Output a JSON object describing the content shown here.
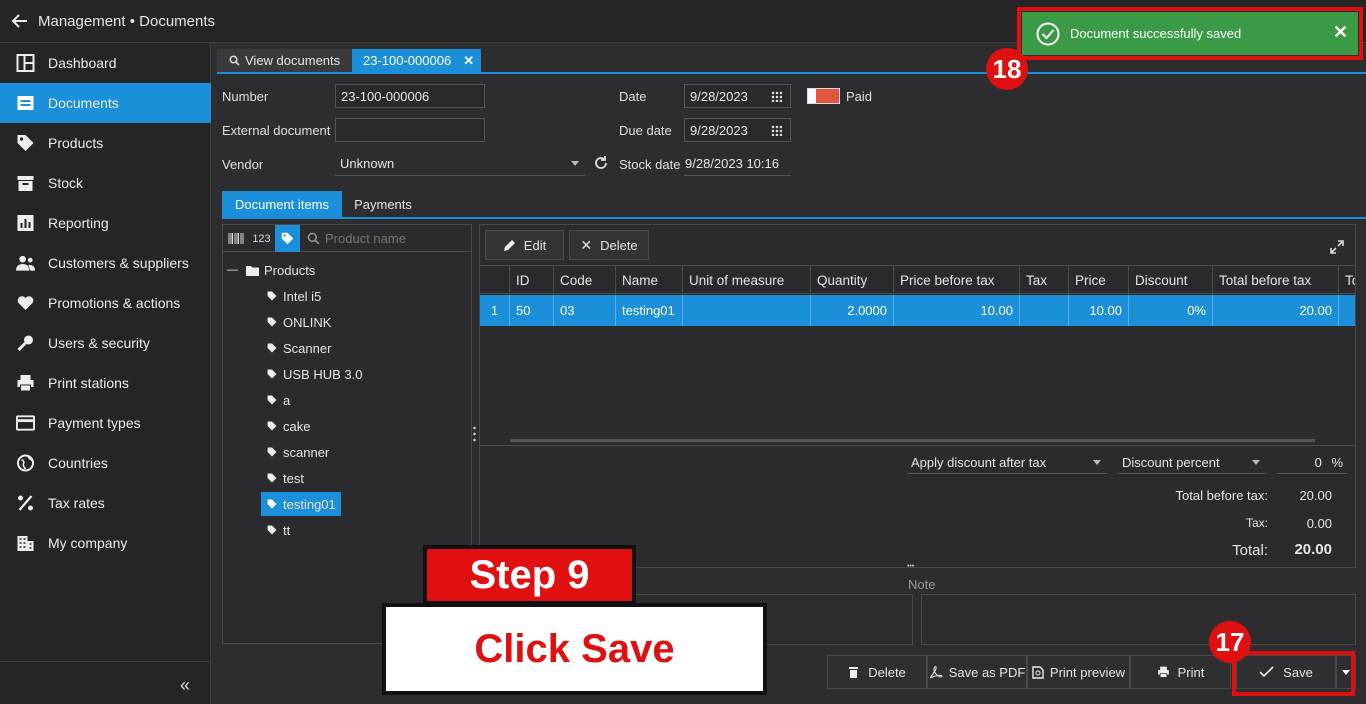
{
  "app": {
    "title": "Management • Documents"
  },
  "sidebar": {
    "items": [
      {
        "label": "Dashboard",
        "icon": "dashboard-icon"
      },
      {
        "label": "Documents",
        "icon": "documents-icon",
        "active": true
      },
      {
        "label": "Products",
        "icon": "tag-icon"
      },
      {
        "label": "Stock",
        "icon": "box-icon"
      },
      {
        "label": "Reporting",
        "icon": "chart-icon"
      },
      {
        "label": "Customers & suppliers",
        "icon": "people-icon"
      },
      {
        "label": "Promotions & actions",
        "icon": "heart-icon"
      },
      {
        "label": "Users & security",
        "icon": "key-icon"
      },
      {
        "label": "Print stations",
        "icon": "printer-icon"
      },
      {
        "label": "Payment types",
        "icon": "card-icon"
      },
      {
        "label": "Countries",
        "icon": "globe-icon"
      },
      {
        "label": "Tax rates",
        "icon": "percent-icon"
      },
      {
        "label": "My company",
        "icon": "building-icon"
      }
    ],
    "collapse_label": "«"
  },
  "tabs": {
    "view": "View documents",
    "doc": "23-100-000006",
    "close": "✕"
  },
  "form": {
    "number_label": "Number",
    "number_value": "23-100-000006",
    "external_label": "External document",
    "external_value": "",
    "vendor_label": "Vendor",
    "vendor_value": "Unknown",
    "date_label": "Date",
    "date_value": "9/28/2023",
    "due_label": "Due date",
    "due_value": "9/28/2023",
    "stock_label": "Stock date",
    "stock_value": "9/28/2023 10:16",
    "paid_label": "Paid"
  },
  "subtabs": {
    "items": "Document items",
    "payments": "Payments"
  },
  "tree": {
    "toolbar": {
      "barcode": "",
      "code": "123"
    },
    "search_placeholder": "Product name",
    "root": "Products",
    "root_toggle": "—",
    "children": [
      "Intel i5",
      "ONLINK",
      "Scanner",
      "USB HUB 3.0",
      "a",
      "cake",
      "scanner",
      "test",
      "testing01",
      "tt"
    ],
    "selected": "testing01"
  },
  "grid": {
    "edit_label": "Edit",
    "delete_label": "Delete",
    "columns": [
      "ID",
      "Code",
      "Name",
      "Unit of measure",
      "Quantity",
      "Price before tax",
      "Tax",
      "Price",
      "Discount",
      "Total before tax",
      "To"
    ],
    "row": {
      "num": "1",
      "id": "50",
      "code": "03",
      "name": "testing01",
      "uom": "",
      "qty": "2.0000",
      "pbt": "10.00",
      "tax": "",
      "price": "10.00",
      "discount": "0%",
      "tbt": "20.00",
      "to": ""
    }
  },
  "totals": {
    "discount_mode": "Apply discount after tax",
    "discount_type": "Discount percent",
    "discount_value": "0",
    "discount_unit": "%",
    "before_tax_label": "Total before tax:",
    "before_tax_value": "20.00",
    "tax_label": "Tax:",
    "tax_value": "0.00",
    "total_label": "Total:",
    "total_value": "20.00"
  },
  "note": {
    "label": "Note",
    "splitter": "• • •"
  },
  "bottom": {
    "delete": "Delete",
    "pdf": "Save as PDF",
    "preview": "Print preview",
    "print": "Print",
    "save": "Save"
  },
  "toast": {
    "text": "Document successfully saved",
    "close": "✕"
  },
  "annotations": {
    "step": "Step 9",
    "instruction": "Click Save",
    "badge_save": "17",
    "badge_toast": "18"
  },
  "colors": {
    "accent": "#1b8fd9",
    "toast": "#3b9a46",
    "annotation_red": "#e01010",
    "paid_toggle": "#e4553f"
  }
}
